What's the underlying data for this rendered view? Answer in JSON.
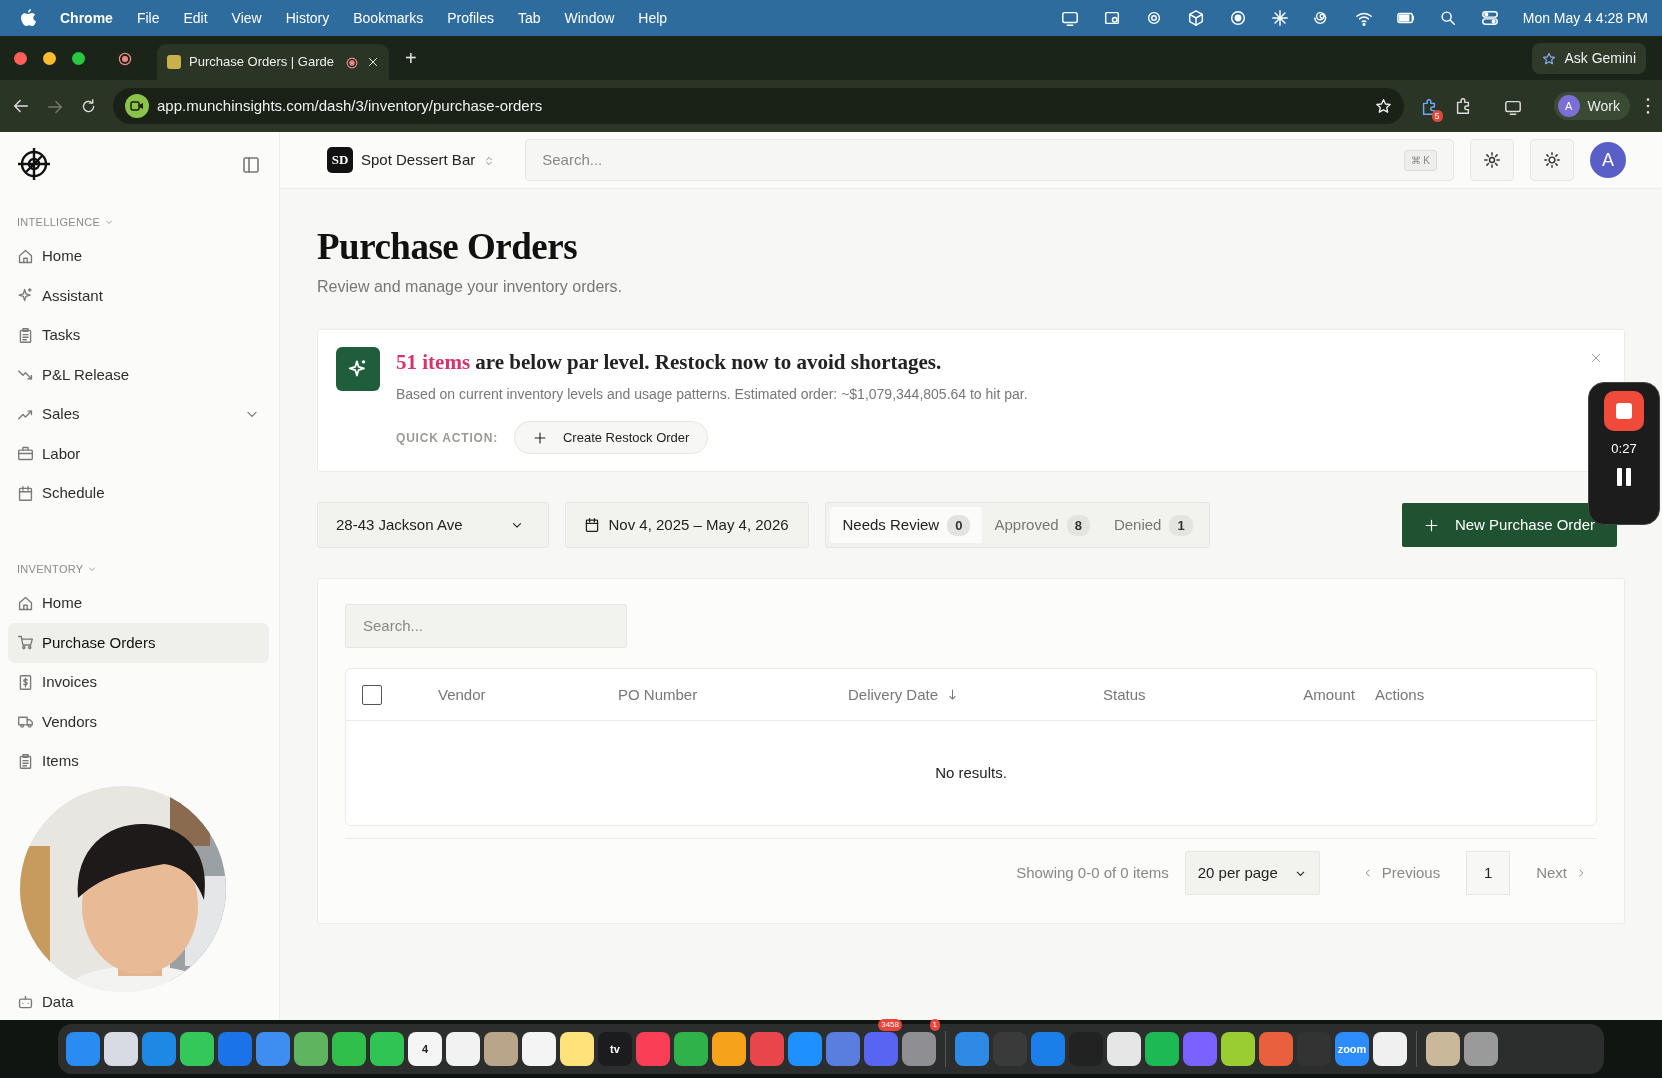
{
  "menubar": {
    "app": "Chrome",
    "menus": [
      "File",
      "Edit",
      "View",
      "History",
      "Bookmarks",
      "Profiles",
      "Tab",
      "Window",
      "Help"
    ],
    "clock": "Mon May 4  4:28 PM"
  },
  "browser": {
    "tabs": [
      {
        "title": "Purchase Orders | Garde",
        "selected": true
      }
    ],
    "new_tab": "+",
    "ask_gemini": "Ask Gemini",
    "url": "app.munchinsights.com/dash/3/inventory/purchase-orders",
    "extension_badge": "5",
    "profile": {
      "initial": "A",
      "name": "Work"
    }
  },
  "header": {
    "store": {
      "initials": "SD",
      "name": "Spot Dessert Bar"
    },
    "search": {
      "placeholder": "Search...",
      "shortcut": "⌘ K"
    },
    "avatar": "A"
  },
  "sidebar": {
    "sections": [
      {
        "title": "INTELLIGENCE",
        "items": [
          {
            "label": "Home",
            "kind": "link",
            "selected": false
          },
          {
            "label": "Assistant",
            "kind": "link",
            "selected": false
          },
          {
            "label": "Tasks",
            "kind": "link",
            "selected": false
          },
          {
            "label": "P&L Release",
            "kind": "link",
            "selected": false
          },
          {
            "label": "Sales",
            "kind": "group",
            "selected": false
          },
          {
            "label": "Labor",
            "kind": "link",
            "selected": false
          },
          {
            "label": "Schedule",
            "kind": "link",
            "selected": false
          }
        ]
      },
      {
        "title": "INVENTORY",
        "items": [
          {
            "label": "Home",
            "kind": "link",
            "selected": false
          },
          {
            "label": "Purchase Orders",
            "kind": "link",
            "selected": true
          },
          {
            "label": "Invoices",
            "kind": "link",
            "selected": false
          },
          {
            "label": "Vendors",
            "kind": "link",
            "selected": false
          },
          {
            "label": "Items",
            "kind": "link",
            "selected": false
          }
        ]
      }
    ],
    "bottom_item": {
      "label": "Data"
    }
  },
  "page": {
    "title": "Purchase Orders",
    "subtitle": "Review and manage your inventory orders."
  },
  "alert": {
    "highlight": "51 items",
    "message": "are below par level. Restock now to avoid shortages.",
    "detail": "Based on current inventory levels and usage patterns. Estimated order: ~$1,079,344,805.64 to hit par.",
    "quick_action_label": "QUICK ACTION:",
    "action": "Create Restock Order"
  },
  "filters": {
    "location": "28-43 Jackson Ave",
    "date_range": "Nov 4, 2025 – May 4, 2026",
    "status_tabs": [
      {
        "label": "Needs Review",
        "count": "0",
        "selected": true
      },
      {
        "label": "Approved",
        "count": "8",
        "selected": false
      },
      {
        "label": "Denied",
        "count": "1",
        "selected": false
      }
    ],
    "new_button": "New Purchase Order"
  },
  "table": {
    "search_placeholder": "Search...",
    "select_all_checked": false,
    "columns": [
      {
        "label": "Vendor",
        "sorted": false
      },
      {
        "label": "PO Number",
        "sorted": false
      },
      {
        "label": "Delivery Date",
        "sorted": true
      },
      {
        "label": "Status",
        "sorted": false
      },
      {
        "label": "Amount",
        "sorted": false
      },
      {
        "label": "Actions",
        "sorted": false
      }
    ],
    "empty_text": "No results."
  },
  "pagination": {
    "summary": "Showing 0-0 of 0 items",
    "page_size": "20 per page",
    "previous": "Previous",
    "page": "1",
    "next": "Next"
  },
  "recorder": {
    "time": "0:27"
  },
  "dock": {
    "apps": [
      {
        "color": "#2a8cf0"
      },
      {
        "color": "#d8dbe4"
      },
      {
        "color": "#1e88e5"
      },
      {
        "color": "#34c759"
      },
      {
        "color": "#1a73e8"
      },
      {
        "color": "#3d8ef0"
      },
      {
        "color": "#5fb55f"
      },
      {
        "color": "#2fbf4a"
      },
      {
        "color": "#30c553"
      },
      {
        "color": "#f5f5f5",
        "label": "4"
      },
      {
        "color": "#f2f2f2"
      },
      {
        "color": "#b9a58a"
      },
      {
        "color": "#f4f4f4"
      },
      {
        "color": "#ffe27a"
      },
      {
        "color": "#1c1c1e",
        "label": "tv"
      },
      {
        "color": "#fa3e56"
      },
      {
        "color": "#30b24a"
      },
      {
        "color": "#f7a21b"
      },
      {
        "color": "#e8464a"
      },
      {
        "color": "#1e90ff"
      },
      {
        "color": "#5a7ee0"
      },
      {
        "color": "#5865f2",
        "badge": "3458"
      },
      {
        "color": "#8e8e93",
        "badge": "1"
      },
      {
        "color": "#2f8ae5"
      },
      {
        "color": "#3a3a3a"
      },
      {
        "color": "#1a7fe8"
      },
      {
        "color": "#222222"
      },
      {
        "color": "#e6e6e6"
      },
      {
        "color": "#1db954"
      },
      {
        "color": "#7b61ff"
      },
      {
        "color": "#9acd32"
      },
      {
        "color": "#e8613c"
      },
      {
        "color": "#333333"
      },
      {
        "color": "#2d8cff",
        "label": "zoom"
      },
      {
        "color": "#f0f0f0"
      },
      {
        "color": "#c9b89a"
      },
      {
        "color": "#9a9a9a"
      }
    ]
  }
}
